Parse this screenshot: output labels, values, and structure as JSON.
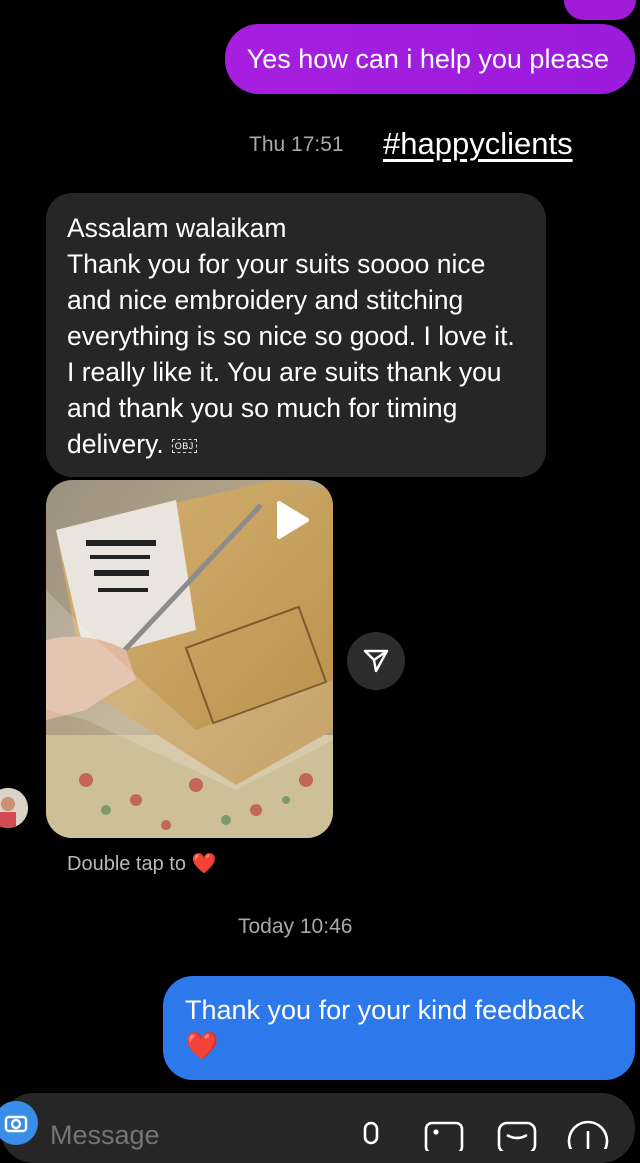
{
  "messages": {
    "outgoing_1": "Yes how can i help you please",
    "timestamp_1": "Thu 17:51",
    "hashtag": "#happyclients",
    "incoming_text": "Assalam walaikam\nThank you for your suits soooo nice and nice embroidery and stitching everything is so nice so good. I love it. I really like it. You are suits thank you and thank you so much for timing delivery.",
    "obj_placeholder": "OBJ",
    "double_tap_label": "Double tap to",
    "heart": "❤️",
    "timestamp_2": "Today 10:46",
    "outgoing_2": "Thank you for your kind feedback",
    "outgoing_2_emoji": "❤️"
  },
  "composer": {
    "placeholder": "Message"
  },
  "colors": {
    "outgoing_purple": "#a21bd8",
    "outgoing_blue": "#2d79ec",
    "incoming_bg": "#262626",
    "background": "#000000"
  },
  "icons": [
    "play-icon",
    "share-icon",
    "camera-icon",
    "mic-icon",
    "gallery-icon",
    "sticker-icon",
    "plus-icon"
  ]
}
